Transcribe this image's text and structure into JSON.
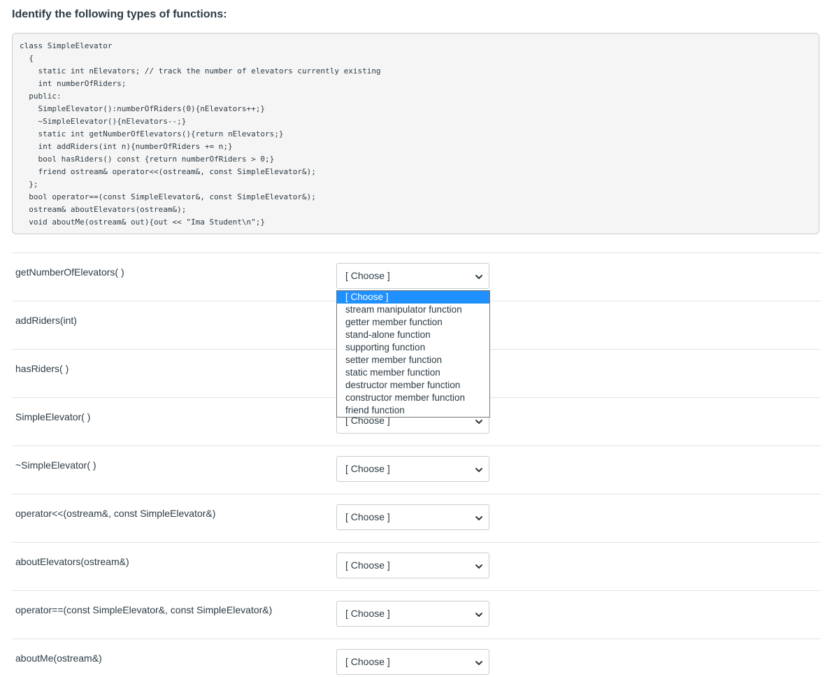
{
  "question": {
    "title": "Identify the following types of functions:"
  },
  "code_lines": [
    "class SimpleElevator",
    "  {",
    "    static int nElevators; // track the number of elevators currently existing",
    "    int numberOfRiders;",
    "  public:",
    "    SimpleElevator():numberOfRiders(0){nElevators++;}",
    "    ~SimpleElevator(){nElevators--;}",
    "    static int getNumberOfElevators(){return nElevators;}",
    "    int addRiders(int n){numberOfRiders += n;}",
    "    bool hasRiders() const {return numberOfRiders > 0;}",
    "    friend ostream& operator<<(ostream&, const SimpleElevator&);",
    "  };",
    "  bool operator==(const SimpleElevator&, const SimpleElevator&);",
    "  ostream& aboutElevators(ostream&);",
    "  void aboutMe(ostream& out){out << \"Ima Student\\n\";}"
  ],
  "rows": [
    {
      "label": "getNumberOfElevators( )",
      "selected": "[ Choose ]"
    },
    {
      "label": "addRiders(int)",
      "selected": "[ Choose ]"
    },
    {
      "label": "hasRiders( )",
      "selected": "[ Choose ]"
    },
    {
      "label": "SimpleElevator( )",
      "selected": "[ Choose ]"
    },
    {
      "label": "~SimpleElevator( )",
      "selected": "[ Choose ]"
    },
    {
      "label": "operator<<(ostream&, const SimpleElevator&)",
      "selected": "[ Choose ]"
    },
    {
      "label": "aboutElevators(ostream&)",
      "selected": "[ Choose ]"
    },
    {
      "label": "operator==(const SimpleElevator&, const SimpleElevator&)",
      "selected": "[ Choose ]"
    },
    {
      "label": "aboutMe(ostream&)",
      "selected": "[ Choose ]"
    }
  ],
  "dropdown": {
    "open_row": 0,
    "highlighted_index": 0,
    "options": [
      "[ Choose ]",
      "stream manipulator function",
      "getter member function",
      "stand-alone function",
      "supporting function",
      "setter member function",
      "static member function",
      "destructor member function",
      "constructor member function",
      "friend function"
    ]
  },
  "icons": {
    "select_arrow": "chevron-down-icon"
  },
  "colors": {
    "highlight": "#1e90ff",
    "text": "#2d3b45",
    "code_background": "#f5f5f5"
  }
}
